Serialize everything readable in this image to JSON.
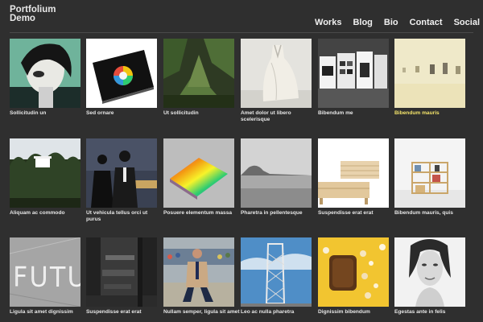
{
  "site": {
    "logo_line1": "Portfolium",
    "logo_line2": "Demo"
  },
  "nav": [
    "Works",
    "Blog",
    "Bio",
    "Contact",
    "Social"
  ],
  "items": [
    {
      "caption": "Sollicitudin un",
      "highlight": false
    },
    {
      "caption": "Sed ornare",
      "highlight": false
    },
    {
      "caption": "Ut sollicitudin",
      "highlight": false
    },
    {
      "caption": "Amet dolor ut libero scelerisque",
      "highlight": false
    },
    {
      "caption": "Bibendum me",
      "highlight": false
    },
    {
      "caption": "Bibendum mauris",
      "highlight": true
    },
    {
      "caption": "Aliquam ac commodo",
      "highlight": false
    },
    {
      "caption": "Ut vehicula tellus orci ut purus",
      "highlight": false
    },
    {
      "caption": "Posuere elementum massa",
      "highlight": false
    },
    {
      "caption": "Pharetra in pellentesque",
      "highlight": false
    },
    {
      "caption": "Suspendisse erat erat",
      "highlight": false
    },
    {
      "caption": "Bibendum mauris, quis",
      "highlight": false
    },
    {
      "caption": "Ligula sit amet dignissim",
      "highlight": false
    },
    {
      "caption": "Suspendisse erat erat",
      "highlight": false
    },
    {
      "caption": "Nullam semper, ligula sit amet",
      "highlight": false
    },
    {
      "caption": "Leo ac nulla pharetra",
      "highlight": false
    },
    {
      "caption": "Dignissim bibendum",
      "highlight": false
    },
    {
      "caption": "Egestas ante in felis",
      "highlight": false
    }
  ],
  "thumb_text": {
    "futu": "FUTU"
  },
  "colors": {
    "background": "#2f2f2f",
    "highlight_caption": "#f4e46a"
  }
}
